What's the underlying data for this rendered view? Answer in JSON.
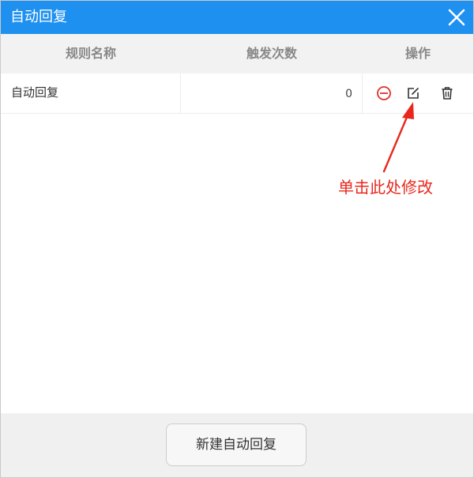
{
  "dialog": {
    "title": "自动回复",
    "header_color": "#1e90f0"
  },
  "table": {
    "columns": [
      "规则名称",
      "触发次数",
      "操作"
    ],
    "rows": [
      {
        "name": "自动回复",
        "count": "0"
      }
    ],
    "actions": [
      "disable-icon",
      "edit-icon",
      "delete-icon"
    ]
  },
  "annotation": {
    "text": "单击此处修改",
    "color": "#e8281d"
  },
  "footer": {
    "new_button_label": "新建自动回复"
  }
}
